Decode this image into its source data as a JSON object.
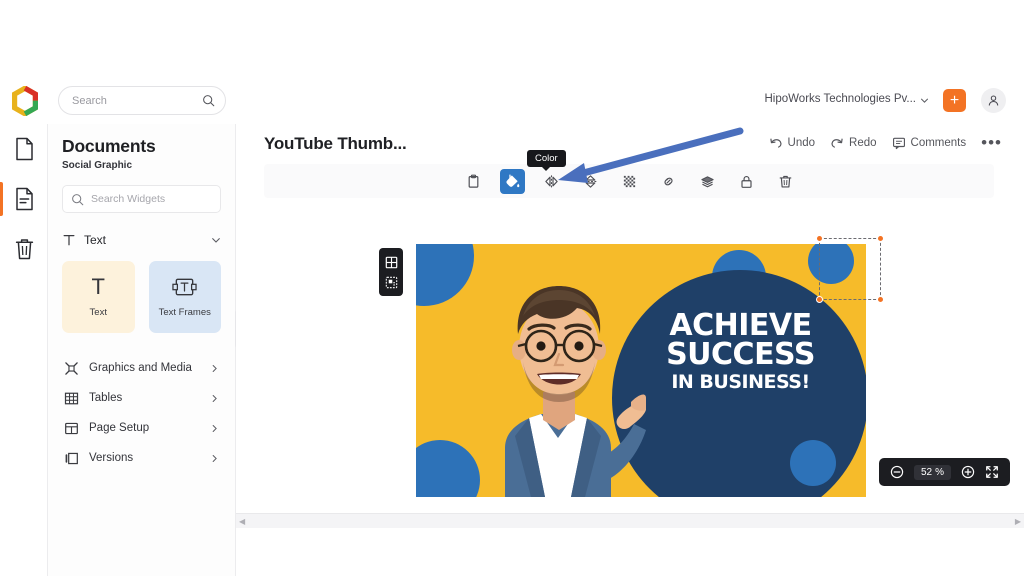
{
  "app": {
    "logo_name": "app-logo"
  },
  "topbar": {
    "search_placeholder": "Search",
    "search_icon": "search-icon",
    "org_name": "HipoWorks Technologies Pv...",
    "org_chevron_icon": "chevron-down-icon",
    "add_label": "+",
    "avatar_icon": "user-avatar-icon"
  },
  "rail": {
    "items": [
      {
        "name": "new-page",
        "icon": "blank-page-icon",
        "active": false
      },
      {
        "name": "document",
        "icon": "document-lines-icon",
        "active": true
      },
      {
        "name": "trash",
        "icon": "trash-icon",
        "active": false
      }
    ]
  },
  "panel": {
    "title": "Documents",
    "subtitle": "Social Graphic",
    "search_placeholder": "Search Widgets",
    "search_icon": "search-icon",
    "section": {
      "label": "Text",
      "icon": "text-T-icon",
      "chevron": "chevron-down-icon"
    },
    "cards": [
      {
        "label": "Text",
        "icon": "text-T-icon"
      },
      {
        "label": "Text Frames",
        "icon": "text-frame-icon"
      }
    ],
    "menu": [
      {
        "label": "Graphics and Media",
        "icon": "graphics-media-icon"
      },
      {
        "label": "Tables",
        "icon": "table-grid-icon"
      },
      {
        "label": "Page Setup",
        "icon": "page-setup-icon"
      },
      {
        "label": "Versions",
        "icon": "versions-icon"
      }
    ],
    "collapse_icon": "chevron-left-icon"
  },
  "main": {
    "doc_title": "YouTube Thumb...",
    "actions": [
      {
        "label": "Undo",
        "icon": "undo-arrow-icon"
      },
      {
        "label": "Redo",
        "icon": "redo-arrow-icon"
      },
      {
        "label": "Comments",
        "icon": "comment-bubble-icon"
      }
    ],
    "more_label": "•••",
    "tooltip": "Color",
    "toolbar": [
      {
        "name": "clipboard",
        "icon": "clipboard-icon",
        "selected": false
      },
      {
        "name": "color",
        "icon": "paint-bucket-icon",
        "selected": true
      },
      {
        "name": "flip-horizontal",
        "icon": "flip-horizontal-icon",
        "selected": false
      },
      {
        "name": "flip-vertical",
        "icon": "flip-vertical-icon",
        "selected": false
      },
      {
        "name": "transparency",
        "icon": "transparency-grid-icon",
        "selected": false
      },
      {
        "name": "link",
        "icon": "link-chain-icon",
        "selected": false
      },
      {
        "name": "layers",
        "icon": "layers-icon",
        "selected": false
      },
      {
        "name": "lock",
        "icon": "lock-icon",
        "selected": false
      },
      {
        "name": "delete",
        "icon": "trash-icon",
        "selected": false
      }
    ]
  },
  "canvas": {
    "artwork": {
      "background_color": "#f6bb2a",
      "accent_blue": "#2d72b8",
      "navy": "#1f4068",
      "headline_line1": "ACHIEVE",
      "headline_line2": "SUCCESS",
      "headline_line3": "IN BUSINESS!"
    },
    "grid_widget": {
      "icons": [
        "grid-layout-icon",
        "crop-frame-icon"
      ]
    },
    "zoom": {
      "out_icon": "zoom-out-icon",
      "value": "52",
      "unit": "%",
      "in_icon": "zoom-in-icon",
      "fit_icon": "fullscreen-fit-icon"
    },
    "scroll_left_icon": "scroll-left-arrow",
    "scroll_right_icon": "scroll-right-arrow"
  },
  "annotation": {
    "arrow_color": "#4a6fbd",
    "name": "blue-pointer-arrow"
  }
}
